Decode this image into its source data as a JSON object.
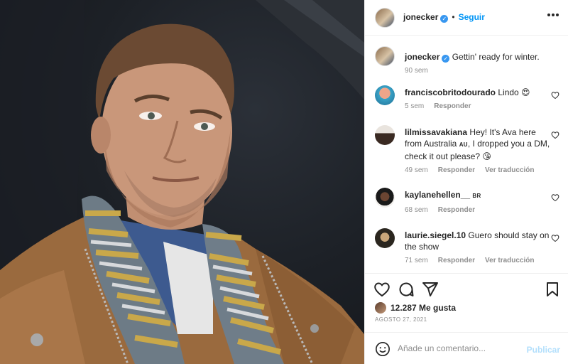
{
  "post": {
    "author": "jonecker",
    "follow_label": "Seguir",
    "caption": "Gettin' ready for winter.",
    "caption_age": "90 sem"
  },
  "comments": [
    {
      "user": "franciscobritodourado",
      "text": "Lindo 😍",
      "country": "",
      "age": "5 sem",
      "reply": "Responder",
      "translate": ""
    },
    {
      "user": "lilmissavakiana",
      "text_before": "Hey! It's Ava here from Australia",
      "country": "AU",
      "text_after": ", I dropped you a DM, check it out please? 😘",
      "age": "49 sem",
      "reply": "Responder",
      "translate": "Ver traducción"
    },
    {
      "user": "kaylanehellen__",
      "country": "BR",
      "age": "68 sem",
      "reply": "Responder",
      "translate": ""
    },
    {
      "user": "laurie.siegel.10",
      "text": "Guero should stay on the show",
      "age": "71 sem",
      "reply": "Responder",
      "translate": "Ver traducción"
    }
  ],
  "stats": {
    "likes": "12.287 Me gusta",
    "date": "AGOSTO 27, 2021"
  },
  "add_comment": {
    "placeholder": "Añade un comentario...",
    "publish_label": "Publicar"
  },
  "icons": [
    "more-icon",
    "like-icon",
    "comment-icon",
    "share-icon",
    "save-icon",
    "emoji-icon",
    "verified-icon"
  ],
  "colors": {
    "accent": "#0095f6",
    "publish_disabled": "#b2dffc",
    "muted": "#8e8e8e",
    "text": "#262626"
  }
}
